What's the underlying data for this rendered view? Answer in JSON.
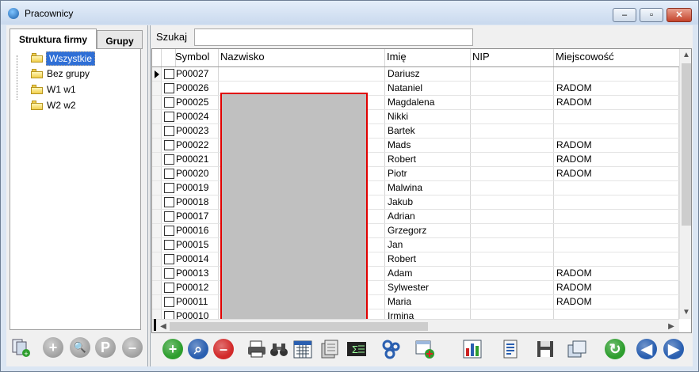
{
  "window": {
    "title": "Pracownicy",
    "minimize_glyph": "–",
    "restore_glyph": "▫",
    "close_glyph": "✕"
  },
  "left_panel": {
    "tabs": [
      {
        "label": "Struktura firmy",
        "active": true
      },
      {
        "label": "Grupy",
        "active": false
      }
    ],
    "tree": [
      {
        "label": "Wszystkie",
        "selected": true
      },
      {
        "label": "Bez grupy",
        "selected": false
      },
      {
        "label": "W1  w1",
        "selected": false
      },
      {
        "label": "W2  w2",
        "selected": false
      }
    ],
    "toolbar": [
      {
        "icon": "group-assign-icon"
      },
      {
        "icon": "add-disabled-icon"
      },
      {
        "icon": "search-disabled-icon"
      },
      {
        "icon": "p-disabled-icon",
        "text": "P"
      },
      {
        "icon": "remove-disabled-icon"
      }
    ]
  },
  "search": {
    "label": "Szukaj",
    "value": ""
  },
  "grid": {
    "columns": [
      "Symbol",
      "Nazwisko",
      "Imię",
      "NIP",
      "Miejscowość"
    ],
    "rows": [
      {
        "symbol": "P00027",
        "nazwisko": "",
        "imie": "Dariusz",
        "nip": "",
        "miejscowosc": "",
        "current": true
      },
      {
        "symbol": "P00026",
        "nazwisko": "",
        "imie": "Nataniel",
        "nip": "",
        "miejscowosc": "RADOM"
      },
      {
        "symbol": "P00025",
        "nazwisko": "",
        "imie": "Magdalena",
        "nip": "",
        "miejscowosc": "RADOM"
      },
      {
        "symbol": "P00024",
        "nazwisko": "",
        "imie": "Nikki",
        "nip": "",
        "miejscowosc": ""
      },
      {
        "symbol": "P00023",
        "nazwisko": "",
        "imie": "Bartek",
        "nip": "",
        "miejscowosc": ""
      },
      {
        "symbol": "P00022",
        "nazwisko": "",
        "imie": "Mads",
        "nip": "",
        "miejscowosc": "RADOM"
      },
      {
        "symbol": "P00021",
        "nazwisko": "",
        "imie": "Robert",
        "nip": "",
        "miejscowosc": "RADOM"
      },
      {
        "symbol": "P00020",
        "nazwisko": "",
        "imie": "Piotr",
        "nip": "",
        "miejscowosc": "RADOM"
      },
      {
        "symbol": "P00019",
        "nazwisko": "",
        "imie": "Malwina",
        "nip": "",
        "miejscowosc": ""
      },
      {
        "symbol": "P00018",
        "nazwisko": "",
        "imie": "Jakub",
        "nip": "",
        "miejscowosc": ""
      },
      {
        "symbol": "P00017",
        "nazwisko": "",
        "imie": "Adrian",
        "nip": "",
        "miejscowosc": ""
      },
      {
        "symbol": "P00016",
        "nazwisko": "",
        "imie": "Grzegorz",
        "nip": "",
        "miejscowosc": ""
      },
      {
        "symbol": "P00015",
        "nazwisko": "",
        "imie": "Jan",
        "nip": "",
        "miejscowosc": ""
      },
      {
        "symbol": "P00014",
        "nazwisko": "",
        "imie": "Robert",
        "nip": "",
        "miejscowosc": ""
      },
      {
        "symbol": "P00013",
        "nazwisko": "",
        "imie": "Adam",
        "nip": "",
        "miejscowosc": "RADOM"
      },
      {
        "symbol": "P00012",
        "nazwisko": "",
        "imie": "Sylwester",
        "nip": "",
        "miejscowosc": "RADOM"
      },
      {
        "symbol": "P00011",
        "nazwisko": "",
        "imie": "Maria",
        "nip": "",
        "miejscowosc": "RADOM"
      },
      {
        "symbol": "P00010",
        "nazwisko": "",
        "imie": "Irmina",
        "nip": "",
        "miejscowosc": ""
      }
    ],
    "redaction_color": "#c0c0c0",
    "highlight_color": "#e00000"
  },
  "toolbar": [
    {
      "icon": "add-icon",
      "color": "#2e9e2e"
    },
    {
      "icon": "search-icon",
      "color": "#2a5fb0"
    },
    {
      "icon": "delete-icon",
      "color": "#d22a2a"
    },
    {
      "icon": "print-icon"
    },
    {
      "icon": "binoculars-icon"
    },
    {
      "icon": "calendar-icon"
    },
    {
      "icon": "archive-icon"
    },
    {
      "icon": "sum-icon",
      "text": "Σ"
    },
    {
      "icon": "settings-icon"
    },
    {
      "icon": "export-icon"
    },
    {
      "icon": "chart-icon"
    },
    {
      "icon": "document-icon"
    },
    {
      "icon": "save-icon"
    },
    {
      "icon": "copy-icon"
    },
    {
      "icon": "refresh-icon",
      "color": "#2e9e2e"
    },
    {
      "icon": "first-record-icon",
      "color": "#2a5fb0"
    },
    {
      "icon": "next-record-icon",
      "color": "#2a5fb0"
    }
  ]
}
